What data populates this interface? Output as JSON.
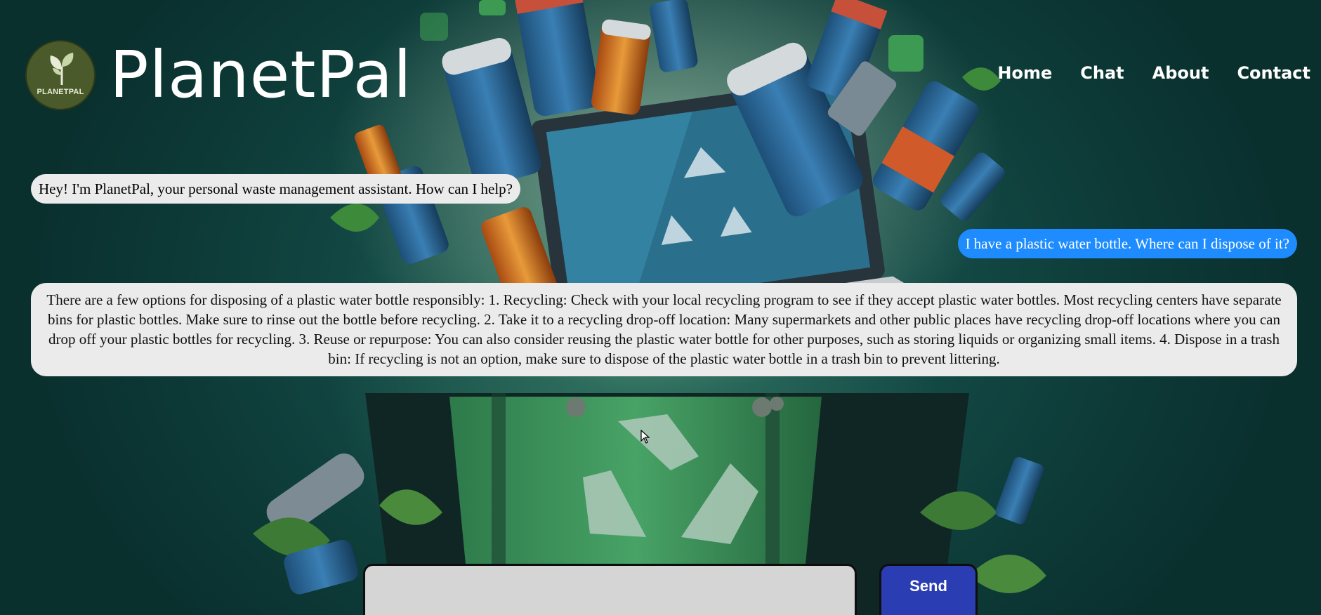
{
  "header": {
    "logo_text": "PLANETPAL",
    "brand": "PlanetPal",
    "nav": [
      "Home",
      "Chat",
      "About",
      "Contact"
    ]
  },
  "chat": {
    "messages": [
      {
        "role": "assistant",
        "text": "Hey! I'm PlanetPal, your personal waste management assistant. How can I help?"
      },
      {
        "role": "user",
        "text": "I have a plastic water bottle. Where can I dispose of it?"
      },
      {
        "role": "assistant",
        "text": "There are a few options for disposing of a plastic water bottle responsibly: 1. Recycling: Check with your local recycling program to see if they accept plastic water bottles. Most recycling centers have separate bins for plastic bottles. Make sure to rinse out the bottle before recycling. 2. Take it to a recycling drop-off location: Many supermarkets and other public places have recycling drop-off locations where you can drop off your plastic bottles for recycling. 3. Reuse or repurpose: You can also consider reusing the plastic water bottle for other purposes, such as storing liquids or organizing small items. 4. Dispose in a trash bin: If recycling is not an option, make sure to dispose of the plastic water bottle in a trash bin to prevent littering."
      }
    ]
  },
  "composer": {
    "input_value": "",
    "send_label": "Send"
  },
  "colors": {
    "user_bubble": "#1e8cff",
    "assistant_bubble": "#ebebeb",
    "send_button": "#2a3db3",
    "background": "#134945"
  },
  "icons": {
    "logo": "leaf-sprout-icon",
    "cursor": "mouse-pointer-icon"
  }
}
